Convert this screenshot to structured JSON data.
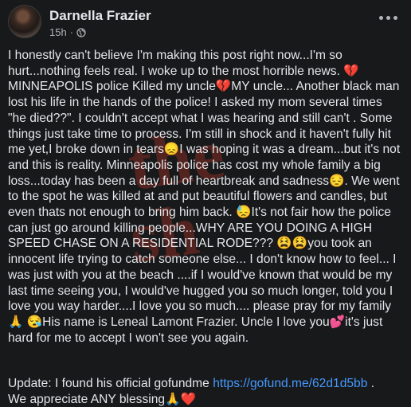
{
  "post": {
    "author": "Darnella Frazier",
    "time": "15h",
    "privacy_icon": "globe-icon",
    "paragraphs": [
      "I honestly can't believe I'm making this post right now...I'm so hurt...nothing feels real. I woke up to the most horrible news. 💔 MINNEAPOLIS police Killed my uncle💔MY uncle... Another black man lost his life in the hands of the police! I asked my mom several times \"he died??\". I couldn't accept what I was hearing and still can't . Some things just take time to process. I'm still in shock and it haven't fully hit me yet,I broke down in tears😞I was hoping it was a dream...but it's not and this is reality. Minneapolis police has cost my whole family a big loss...today has been a day full of heartbreak and sadness😔. We went to the spot he was killed at and put beautiful flowers and candles, but even thats not enough to bring him back. 😓It's not fair how the police can just go around killing people...WHY ARE YOU DOING A HIGH SPEED CHASE ON A RESIDENTIAL RODE??? 😫😫you took an innocent life trying to catch someone else... I don't know how to feel... I was just with you at the beach ....if I would've known that would be my last time seeing you, I would've hugged you so much longer, told you I love you way harder....I love you so much.... please pray for my family 🙏 😪His name is Leneal Lamont Frazier. Uncle I love you💕it's just hard for me to accept I won't see you again."
    ],
    "update_prefix": "Update: I found his official gofundme ",
    "update_link": "https://gofund.me/62d1d5bb",
    "update_suffix": " .",
    "update_line2": "We appreciate ANY blessing🙏❤️"
  }
}
